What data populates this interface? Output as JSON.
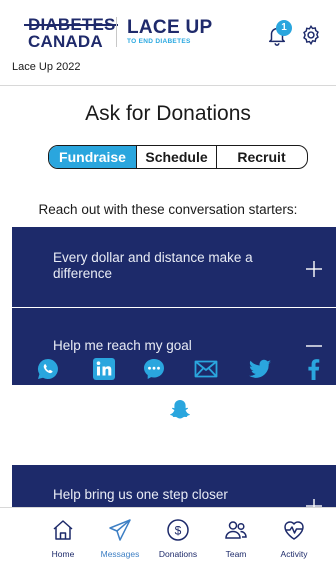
{
  "header": {
    "brand_org_line1": "DIABETES",
    "brand_org_line2": "CANADA",
    "brand_campaign": "LACE UP",
    "brand_tagline": "TO END DIABETES",
    "notification_count": "1",
    "event_name": "Lace Up 2022"
  },
  "page": {
    "title": "Ask for Donations",
    "intro": "Reach out with these conversation starters:"
  },
  "tabs": [
    {
      "label": "Fundraise",
      "active": true
    },
    {
      "label": "Schedule",
      "active": false
    },
    {
      "label": "Recruit",
      "active": false
    }
  ],
  "accordion": [
    {
      "label": "Every dollar and distance make a difference",
      "state": "collapsed"
    },
    {
      "label": "Help me reach my goal",
      "state": "expanded"
    },
    {
      "label": "Help bring us one step closer",
      "state": "collapsed"
    }
  ],
  "share_icons": [
    "whatsapp-icon",
    "linkedin-icon",
    "messenger-icon",
    "email-icon",
    "twitter-icon",
    "facebook-icon",
    "snapchat-icon"
  ],
  "nav": [
    {
      "label": "Home",
      "icon": "home-icon",
      "active": false
    },
    {
      "label": "Messages",
      "icon": "messages-icon",
      "active": true
    },
    {
      "label": "Donations",
      "icon": "donations-icon",
      "active": false
    },
    {
      "label": "Team",
      "icon": "team-icon",
      "active": false
    },
    {
      "label": "Activity",
      "icon": "activity-icon",
      "active": false
    }
  ],
  "colors": {
    "brand_navy": "#1d2a6a",
    "accent_blue": "#2aa6de",
    "active_nav": "#3d7fc4"
  }
}
